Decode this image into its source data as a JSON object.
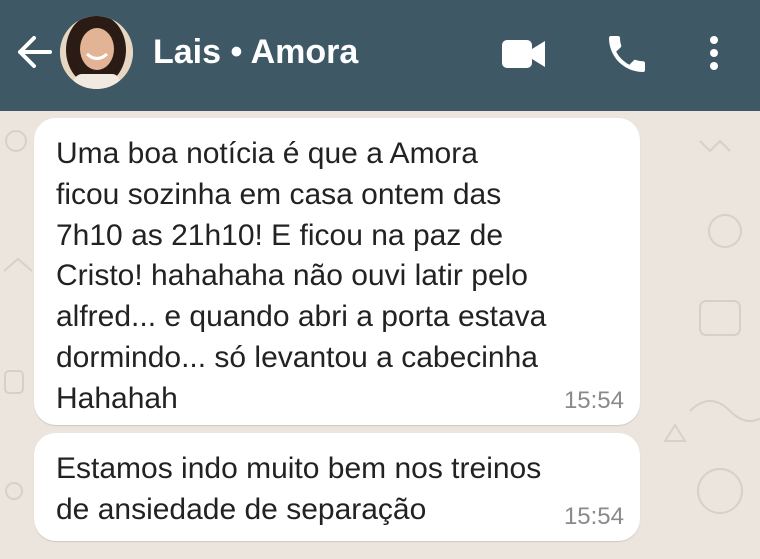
{
  "header": {
    "title": "Lais • Amora",
    "back_icon": "arrow-left-icon",
    "video_icon": "video-camera-icon",
    "call_icon": "phone-icon",
    "menu_icon": "more-vertical-icon",
    "colors": {
      "header_bg": "#3f5866",
      "header_text": "#ffffff"
    }
  },
  "chat": {
    "background_color": "#ece5dd",
    "bubble_color": "#ffffff",
    "messages": [
      {
        "text": "Uma boa notícia é que a Amora\nficou sozinha em casa ontem das\n7h10 as 21h10! E ficou na paz de\nCristo! hahahaha não ouvi latir pelo\nalfred... e quando abri a porta estava\ndormindo... só levantou a cabecinha\nHahahah",
        "time": "15:54"
      },
      {
        "text": "Estamos indo muito bem nos treinos\nde ansiedade de separação",
        "time": "15:54"
      }
    ]
  }
}
